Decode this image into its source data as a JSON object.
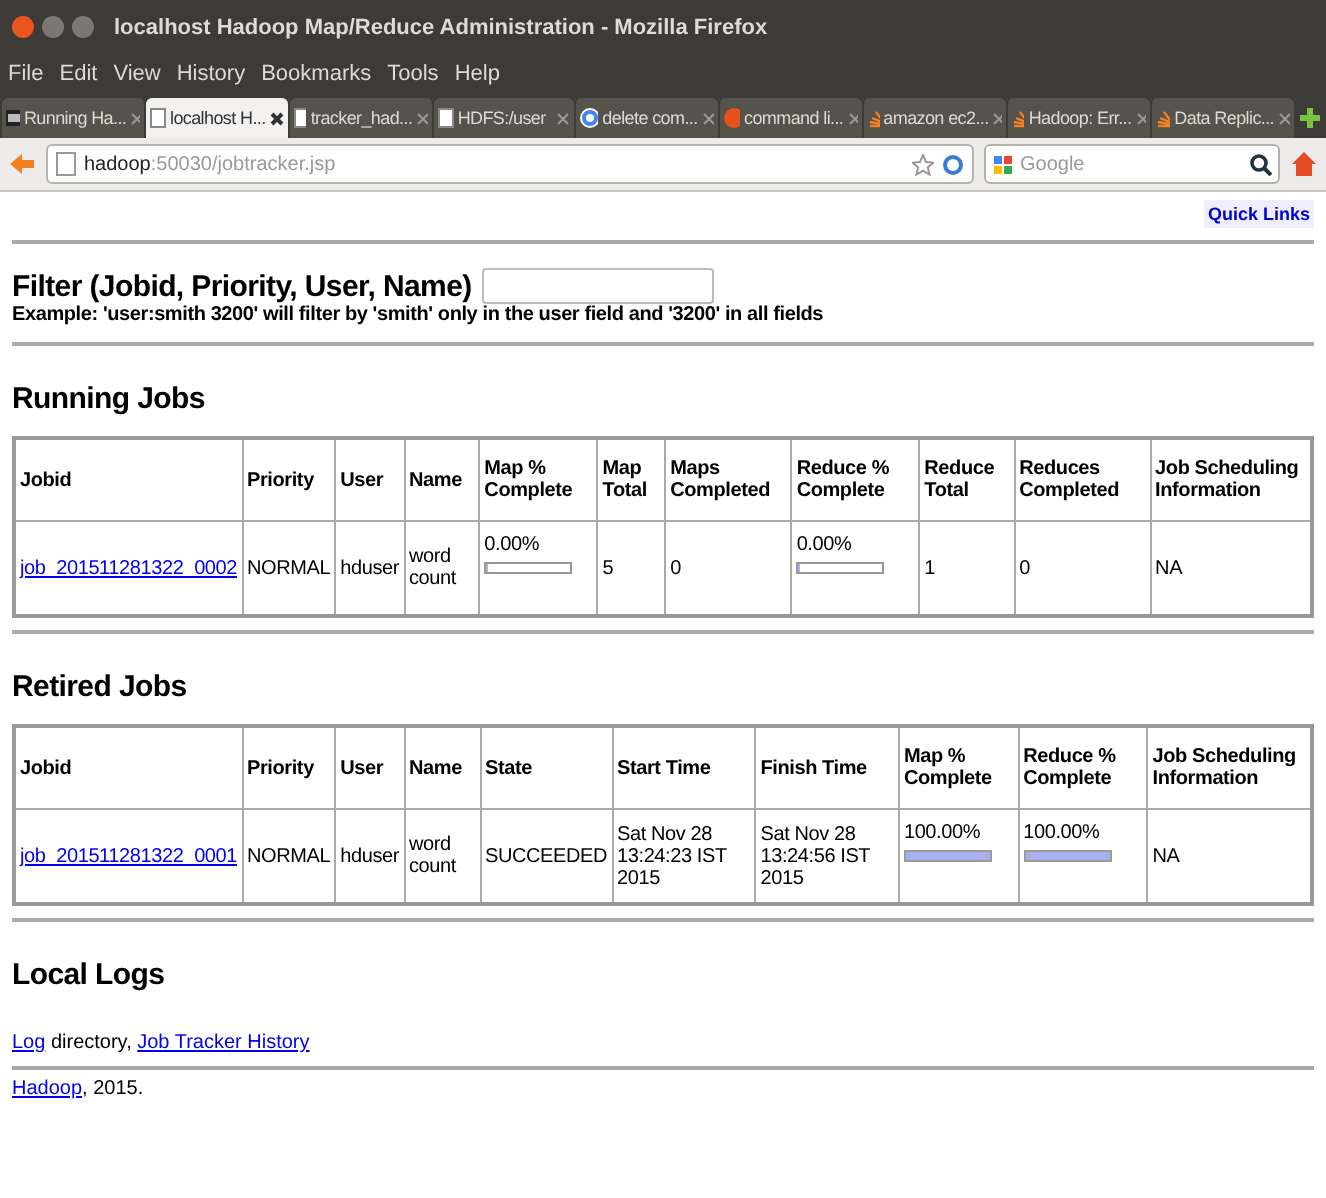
{
  "window": {
    "title": "localhost Hadoop Map/Reduce Administration - Mozilla Firefox"
  },
  "menu": [
    "File",
    "Edit",
    "View",
    "History",
    "Bookmarks",
    "Tools",
    "Help"
  ],
  "tabs": [
    {
      "label": "Running Ha...",
      "selected": false
    },
    {
      "label": "localhost H...",
      "selected": true
    },
    {
      "label": "tracker_had...",
      "selected": false
    },
    {
      "label": "HDFS:/user",
      "selected": false
    },
    {
      "label": "delete com...",
      "selected": false
    },
    {
      "label": "command li...",
      "selected": false
    },
    {
      "label": "amazon ec2...",
      "selected": false
    },
    {
      "label": "Hadoop: Err...",
      "selected": false
    },
    {
      "label": "Data Replic...",
      "selected": false
    }
  ],
  "address": {
    "host": "hadoop",
    "path": ":50030/jobtracker.jsp"
  },
  "search": {
    "placeholder": "Google"
  },
  "quick_links": "Quick Links",
  "filter": {
    "label": "Filter (Jobid, Priority, User, Name)",
    "example": "Example: 'user:smith 3200' will filter by 'smith' only in the user field and '3200' in all fields"
  },
  "running_jobs": {
    "heading": "Running Jobs",
    "columns": [
      "Jobid",
      "Priority",
      "User",
      "Name",
      "Map % Complete",
      "Map Total",
      "Maps Completed",
      "Reduce % Complete",
      "Reduce Total",
      "Reduces Completed",
      "Job Scheduling Information"
    ],
    "rows": [
      [
        {
          "kind": "link",
          "text": "job_201511281322_0002"
        },
        {
          "kind": "text",
          "text": "NORMAL"
        },
        {
          "kind": "text",
          "text": "hduser"
        },
        {
          "kind": "text",
          "text": "word count"
        },
        {
          "kind": "progress",
          "text": "0.00%",
          "level": 0
        },
        {
          "kind": "text",
          "text": "5"
        },
        {
          "kind": "text",
          "text": "0"
        },
        {
          "kind": "progress",
          "text": "0.00%",
          "level": 0
        },
        {
          "kind": "text",
          "text": "1"
        },
        {
          "kind": "text",
          "text": "0"
        },
        {
          "kind": "text",
          "text": "NA"
        }
      ]
    ]
  },
  "retired_jobs": {
    "heading": "Retired Jobs",
    "columns": [
      "Jobid",
      "Priority",
      "User",
      "Name",
      "State",
      "Start Time",
      "Finish Time",
      "Map % Complete",
      "Reduce % Complete",
      "Job Scheduling Information"
    ],
    "rows": [
      [
        {
          "kind": "link",
          "text": "job_201511281322_0001"
        },
        {
          "kind": "text",
          "text": "NORMAL"
        },
        {
          "kind": "text",
          "text": "hduser"
        },
        {
          "kind": "text",
          "text": "word count"
        },
        {
          "kind": "text",
          "text": "SUCCEEDED"
        },
        {
          "kind": "text",
          "text": "Sat Nov 28 13:24:23 IST 2015"
        },
        {
          "kind": "text",
          "text": "Sat Nov 28 13:24:56 IST 2015"
        },
        {
          "kind": "progress",
          "text": "100.00%",
          "level": 1
        },
        {
          "kind": "progress",
          "text": "100.00%",
          "level": 1
        },
        {
          "kind": "text",
          "text": "NA"
        }
      ]
    ]
  },
  "local_logs": {
    "heading": "Local Logs",
    "parts": [
      {
        "kind": "link",
        "text": "Log"
      },
      {
        "kind": "text",
        "text": " directory, "
      },
      {
        "kind": "link",
        "text": "Job Tracker History"
      }
    ]
  },
  "footer": {
    "parts": [
      {
        "kind": "link",
        "text": "Hadoop"
      },
      {
        "kind": "text",
        "text": ", 2015."
      }
    ]
  }
}
